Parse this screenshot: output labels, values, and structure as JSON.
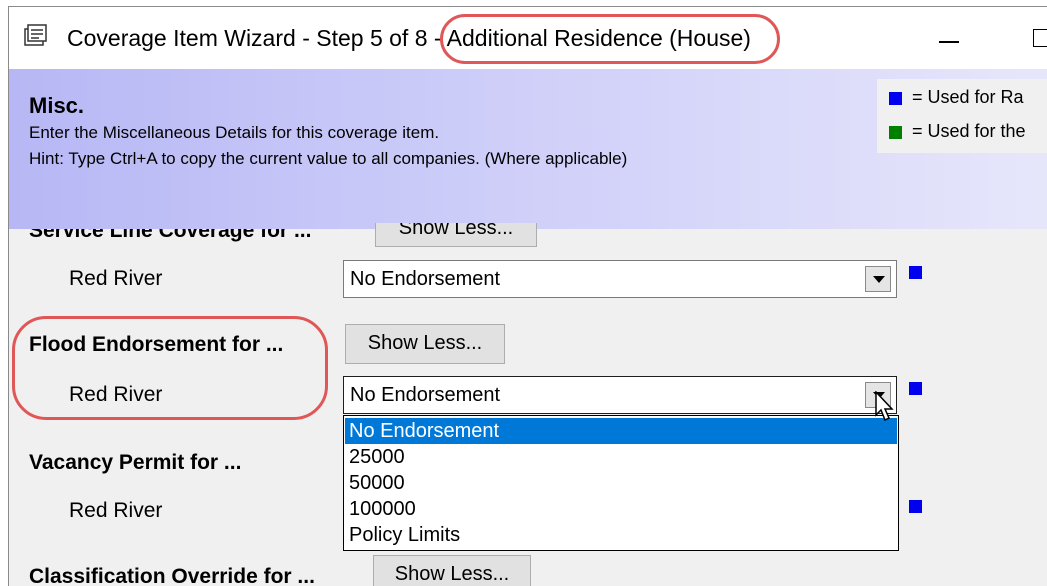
{
  "window": {
    "title": "Coverage Item Wizard - Step 5 of 8 - Additional Residence (House)"
  },
  "banner": {
    "title": "Misc.",
    "description": "Enter the Miscellaneous Details for this coverage item.",
    "hint": "Hint: Type Ctrl+A to copy the current value to all companies. (Where applicable)"
  },
  "legend": {
    "items": [
      {
        "color": "#0000ee",
        "label": "= Used for Ra"
      },
      {
        "color": "#008000",
        "label": "= Used for the"
      }
    ]
  },
  "sections": [
    {
      "title": "Service Line Coverage for ...",
      "button": "Show Less...",
      "company": "Red River",
      "value": "No Endorsement"
    },
    {
      "title": "Flood Endorsement for ...",
      "button": "Show Less...",
      "company": "Red River",
      "value": "No Endorsement"
    },
    {
      "title": "Vacancy Permit for ...",
      "company": "Red River"
    },
    {
      "title": "Classification Override for ...",
      "button": "Show Less..."
    }
  ],
  "dropdown": {
    "options": [
      "No Endorsement",
      "25000",
      "50000",
      "100000",
      "Policy Limits"
    ],
    "selected": "No Endorsement"
  },
  "colors": {
    "annotation": "#e05757",
    "selection": "#0078d7",
    "rating_marker": "#0000ee"
  }
}
